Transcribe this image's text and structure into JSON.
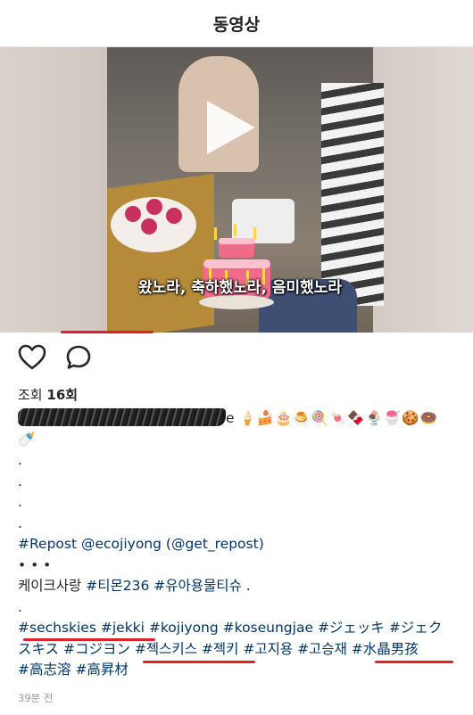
{
  "header": {
    "title": "동영상"
  },
  "video": {
    "subtitle": "왔노라, 축하했노라, 음미했노라",
    "repost_user": "ecojiyong"
  },
  "actions": {
    "like_icon": "heart-icon",
    "comment_icon": "comment-icon"
  },
  "views": {
    "label": "조회",
    "count": "16회"
  },
  "caption": {
    "line1_suffix": "e",
    "line1_emojis": "🍦🍰🎂🍮🍭🍬🍫🍨🍧🍪🍩",
    "line2_emojis": "🍼",
    "dot": ".",
    "repost": "#Repost @ecojiyong (@get_repost)",
    "bullets": "• • •",
    "ko_tags": [
      "케이크사랑",
      "#티몬236",
      "#유아용물티슈",
      "."
    ],
    "dot2": ".",
    "tags_line1": [
      "#sechskies",
      "#jekki",
      "#kojiyong",
      "#koseungjae",
      "#ジェッキ",
      "#ジェク"
    ],
    "tags_line2": [
      "スキス",
      "#コジヨン",
      "#젝스키스",
      "#젝키",
      "#고지용",
      "#고승재",
      "#水晶男孩"
    ],
    "tags_line3": [
      "#高志溶",
      "#高昇材"
    ]
  },
  "timestamp": "39분 전"
}
